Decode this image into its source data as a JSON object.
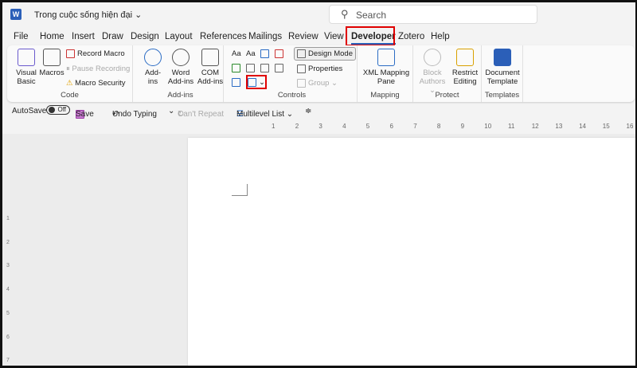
{
  "titlebar": {
    "app_icon": "word-icon",
    "doc_title": "Trong cuộc sống hiện đại ⌄",
    "search_placeholder": "Search",
    "search_icon": "search-icon"
  },
  "tabs": [
    "File",
    "Home",
    "Insert",
    "Draw",
    "Design",
    "Layout",
    "References",
    "Mailings",
    "Review",
    "View",
    "Developer",
    "Zotero",
    "Help"
  ],
  "active_tab": "Developer",
  "highlight_color": "#e00000",
  "ribbon": {
    "code": {
      "label": "Code",
      "visual_basic": "Visual Basic",
      "macros": "Macros",
      "record_macro": "Record Macro",
      "pause_recording": "Pause Recording",
      "macro_security": "Macro Security"
    },
    "addins": {
      "label": "Add-ins",
      "addins": "Add-ins",
      "word_addins": "Word Add-ins",
      "com_addins": "COM Add-ins"
    },
    "controls": {
      "label": "Controls",
      "design_mode": "Design Mode",
      "properties": "Properties",
      "group": "Group ⌄",
      "rich_text": "Aa",
      "plain_text": "Aa"
    },
    "mapping": {
      "label": "Mapping",
      "xml_pane": "XML Mapping Pane"
    },
    "protect": {
      "label": "Protect",
      "block_authors": "Block Authors ⌄",
      "restrict_editing": "Restrict Editing"
    },
    "templates": {
      "label": "Templates",
      "document_template": "Document Template"
    }
  },
  "qat": {
    "autosave": "AutoSave",
    "toggle": "Off",
    "save": "Save",
    "undo": "Undo Typing",
    "undo_arrow": "⌄",
    "repeat": "Can't Repeat",
    "multilevel": "Multilevel List ⌄",
    "customize": "≑"
  },
  "ruler": {
    "labels": [
      "1",
      "2",
      "3",
      "4",
      "5",
      "6",
      "7",
      "8",
      "9",
      "10",
      "11",
      "12",
      "13",
      "14",
      "15",
      "16"
    ]
  },
  "vruler": {
    "labels": [
      "1",
      "2",
      "3",
      "4",
      "5",
      "6",
      "7"
    ]
  }
}
